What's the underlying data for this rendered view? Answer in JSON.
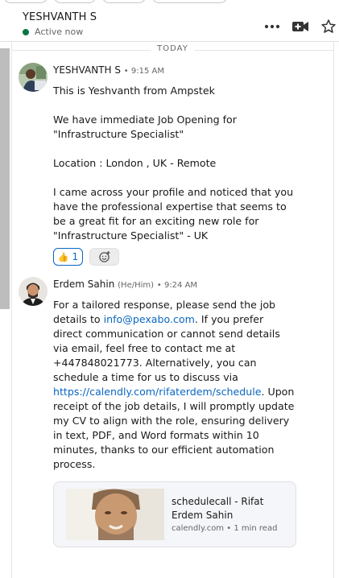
{
  "header": {
    "contact_name": "YESHVANTH S",
    "presence": "Active now",
    "icons": [
      "more-icon",
      "video-call-icon",
      "star-icon"
    ]
  },
  "divider": {
    "label": "TODAY"
  },
  "messages": [
    {
      "sender": "YESHVANTH S",
      "pronouns": "",
      "time": "9:15 AM",
      "paragraphs": [
        "This is Yeshvanth from Ampstek",
        "We have immediate Job Opening for\n\"Infrastructure Specialist\"",
        "Location : London , UK - Remote",
        "I came across your profile and noticed that you have the professional expertise that seems to be a great fit for an exciting new role for \"Infrastructure Specialist\" - UK"
      ],
      "reactions": [
        {
          "emoji": "👍",
          "count": "1"
        }
      ]
    },
    {
      "sender": "Erdem Sahin",
      "pronouns": "(He/Him)",
      "time": "9:24 AM",
      "text_1": "For a tailored response, please send the job details to ",
      "email": "info@pexabo.com",
      "text_2": ". If you prefer direct communication or cannot send details via email, feel free to contact me at +447848021773. Alternatively, you can schedule a time for us to discuss via ",
      "url": "https://calendly.com/rifaterdem/schedule",
      "text_3": ". Upon receipt of the job details, I will promptly update my CV to align with the role, ensuring delivery in text, PDF, and Word formats within 10 minutes, thanks to our efficient automation process.",
      "link_preview": {
        "title": "schedulecall - Rifat Erdem Sahin",
        "domain": "calendly.com",
        "read_time": "1 min read"
      }
    }
  ],
  "colors": {
    "link": "#0a66c2",
    "presence": "#057642",
    "text": "#191919",
    "muted": "#666666"
  }
}
